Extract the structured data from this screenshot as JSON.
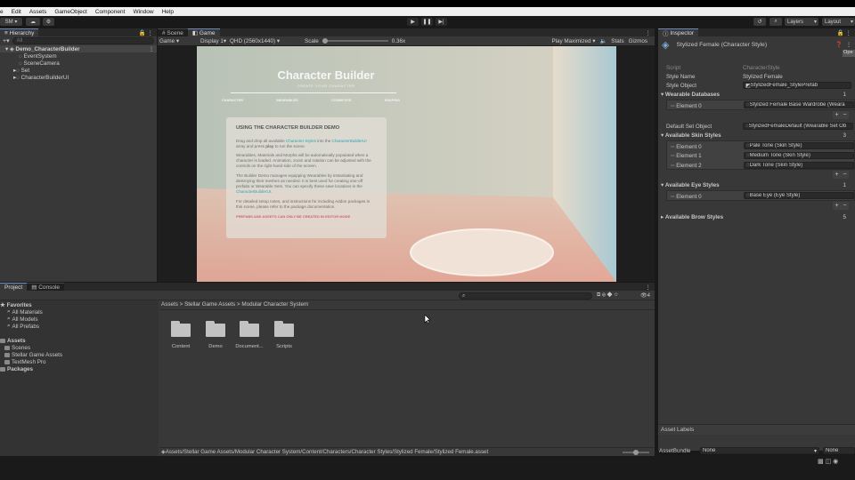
{
  "menu": [
    "e",
    "Edit",
    "Assets",
    "GameObject",
    "Component",
    "Window",
    "Help"
  ],
  "toolbar": {
    "account": "SM",
    "layers": "Layers",
    "layout": "Layout"
  },
  "hierarchy": {
    "tab": "Hierarchy",
    "search_placeholder": "All",
    "items": [
      "Demo_CharacterBuilder",
      "EventSystem",
      "SceneCamera",
      "Set",
      "CharacterBuilderUI"
    ]
  },
  "game": {
    "tabs": [
      "Scene",
      "Game"
    ],
    "mode": "Game",
    "display": "Display 1",
    "resolution": "QHD (2560x1440)",
    "scale_label": "Scale",
    "scale_value": "0.36x",
    "play_maximized": "Play Maximized",
    "stats": "Stats",
    "gizmos": "Gizmos"
  },
  "viewport": {
    "title": "Character Builder",
    "subtitle": "CREATE YOUR CHARACTER",
    "nav": [
      "CHARACTER",
      "WEARABLES",
      "COSMETICS",
      "SHAPING"
    ],
    "card_title": "USING THE CHARACTER BUILDER DEMO",
    "p1a": "Drag and drop all available ",
    "p1_link1": "Character Styles",
    "p1b": " into the ",
    "p1_link2": "CharacterBuilderUI",
    "p1c": " array and press ",
    "p1_play": "play",
    "p1d": " to run the scene.",
    "p2": "Wearables, Materials and Morphs will be automatically populated when a character is loaded. Animation, zoom and rotation can be adjusted with the controls on the right-hand side of the screen.",
    "p3a": "The Builder Demo manages equipping Wearables by instantiating and destroying their meshes as needed. It is best used for creating one-off prefabs or Wearable Sets. You can specify these save locations in the ",
    "p3_link": "CharacterBuilderUI",
    "p3b": ".",
    "p4": "For detailed setup notes, and instructions for including Addon packages in this scene, please refer to the package documentation.",
    "warning": "PREFABS AND ASSETS CAN ONLY BE CREATED IN EDITOR MODE"
  },
  "inspector": {
    "tab": "Inspector",
    "object_title": "Stylized Female (Character Style)",
    "open": "Ope",
    "script_label": "Script",
    "script_value": "CharacterStyle",
    "style_name_label": "Style Name",
    "style_name_value": "Stylized Female",
    "style_object_label": "Style Object",
    "style_object_value": "StylizedFemale_StylePrefab",
    "wearable_db_label": "Wearable Databases",
    "wearable_db_count": "1",
    "wearable_db_elements": [
      {
        "label": "Element 0",
        "value": "Stylized Female Base Wardrobe (Weara"
      }
    ],
    "default_set_label": "Default Set Object",
    "default_set_value": "StylizedFemaleDefault (Wearable Set Ob",
    "skin_label": "Available Skin Styles",
    "skin_count": "3",
    "skin_elements": [
      {
        "label": "Element 0",
        "value": "Pale Tone (Skin Style)"
      },
      {
        "label": "Element 1",
        "value": "Medium Tone (Skin Style)"
      },
      {
        "label": "Element 2",
        "value": "Dark Tone (Skin Style)"
      }
    ],
    "eye_label": "Available Eye Styles",
    "eye_count": "1",
    "eye_elements": [
      {
        "label": "Element 0",
        "value": "Base Eye (Eye Style)"
      }
    ],
    "brow_label": "Available Brow Styles",
    "brow_count": "5",
    "asset_labels": "Asset Labels",
    "asset_bundle_label": "AssetBundle",
    "asset_bundle_value": "None",
    "asset_bundle_variant": "None"
  },
  "project": {
    "tabs": [
      "Project",
      "Console"
    ],
    "favorites_label": "Favorites",
    "favorites": [
      "All Materials",
      "All Models",
      "All Prefabs"
    ],
    "assets_label": "Assets",
    "assets": [
      "Scenes",
      "Stellar Game Assets",
      "TextMesh Pro"
    ],
    "packages_label": "Packages",
    "breadcrumb": [
      "Assets",
      "Stellar Game Assets",
      "Modular Character System"
    ],
    "folders": [
      "Content",
      "Demo",
      "Document...",
      "Scripts"
    ],
    "path": "Assets/Stellar Game Assets/Modular Character System/Content/Characters/Character Styles/Stylized Female/Stylized Female.asset",
    "count": "4"
  },
  "colors": {
    "link": "#2fa4ad",
    "warning": "#d0607a",
    "accent_blue": "#6a8ac6"
  }
}
